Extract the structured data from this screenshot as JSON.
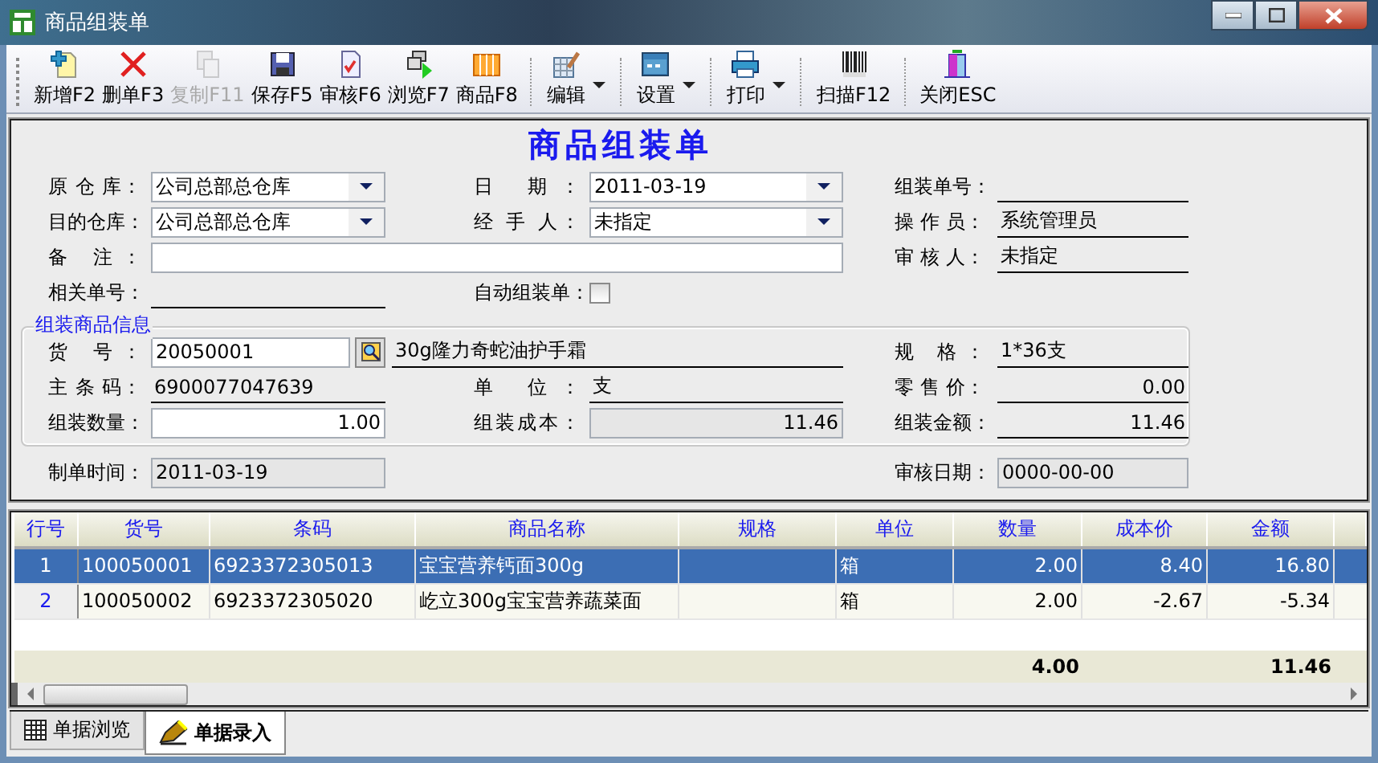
{
  "window": {
    "title": "商品组装单"
  },
  "toolbar": [
    {
      "kind": "button",
      "label": "新增F2",
      "disabled": false,
      "dropdown": false
    },
    {
      "kind": "button",
      "label": "删单F3",
      "disabled": false,
      "dropdown": false
    },
    {
      "kind": "button",
      "label": "复制F11",
      "disabled": true,
      "dropdown": false
    },
    {
      "kind": "button",
      "label": "保存F5",
      "disabled": false,
      "dropdown": false
    },
    {
      "kind": "button",
      "label": "审核F6",
      "disabled": false,
      "dropdown": false
    },
    {
      "kind": "button",
      "label": "浏览F7",
      "disabled": false,
      "dropdown": false
    },
    {
      "kind": "button",
      "label": "商品F8",
      "disabled": false,
      "dropdown": false
    },
    {
      "kind": "separator"
    },
    {
      "kind": "button",
      "label": "编辑",
      "disabled": false,
      "dropdown": true
    },
    {
      "kind": "separator"
    },
    {
      "kind": "button",
      "label": "设置",
      "disabled": false,
      "dropdown": true
    },
    {
      "kind": "separator"
    },
    {
      "kind": "button",
      "label": "打印",
      "disabled": false,
      "dropdown": true
    },
    {
      "kind": "separator"
    },
    {
      "kind": "button",
      "label": "扫描F12",
      "disabled": false,
      "dropdown": false
    },
    {
      "kind": "separator"
    },
    {
      "kind": "button",
      "label": "关闭ESC",
      "disabled": false,
      "dropdown": false
    }
  ],
  "form": {
    "title": "商品组装单",
    "rows": [
      {
        "left": {
          "label": "原 仓 库：",
          "kind": "combo",
          "value": "公司总部总仓库"
        },
        "middle": {
          "label": "日 期：",
          "kind": "combo",
          "value": "2011-03-19"
        },
        "right": {
          "label": "组装单号：",
          "kind": "line"
        }
      },
      {
        "left": {
          "label": "目的仓库：",
          "kind": "combo",
          "value": "公司总部总仓库"
        },
        "middle": {
          "label": "经 手 人：",
          "kind": "combo",
          "value": "未指定"
        },
        "right": {
          "label": "操 作 员：",
          "kind": "line",
          "value": "系统管理员"
        }
      },
      {
        "left": {
          "label": "备 注：",
          "kind": "wide-input"
        },
        "right": {
          "label": "审 核 人：",
          "kind": "line",
          "value": "未指定"
        }
      },
      {
        "left": {
          "label": "相关单号：",
          "kind": "line"
        },
        "middle": {
          "label": "自动组装单：",
          "kind": "checkbox",
          "checked": false
        }
      }
    ],
    "group": {
      "title": "组装商品信息",
      "rows": [
        {
          "left": {
            "label": "货 号：",
            "kind": "lookup",
            "value": "20050001"
          },
          "middle": {
            "kind": "name-line",
            "value": "30g隆力奇蛇油护手霜"
          },
          "right": {
            "label": "规 格：",
            "kind": "line",
            "value": "1*36支"
          }
        },
        {
          "left": {
            "label": "主 条 码：",
            "kind": "line",
            "value": "6900077047639"
          },
          "middle": {
            "label": "单 位：",
            "kind": "line",
            "value": "支"
          },
          "right": {
            "label": "零 售 价：",
            "kind": "line-num",
            "value": "0.00"
          }
        },
        {
          "left": {
            "label": "组装数量：",
            "kind": "input-num",
            "value": "1.00"
          },
          "middle": {
            "label": "组装成本：",
            "kind": "readonly-num",
            "value": "11.46"
          },
          "right": {
            "label": "组装金额：",
            "kind": "line-num",
            "value": "11.46"
          }
        }
      ]
    },
    "footer_rows": [
      {
        "left": {
          "label": "制单时间：",
          "kind": "readonly",
          "value": "2011-03-19"
        },
        "right": {
          "label": "审核日期：",
          "kind": "readonly",
          "value": "0000-00-00"
        }
      }
    ]
  },
  "table": {
    "columns": [
      "行号",
      "货号",
      "条码",
      "商品名称",
      "规格",
      "单位",
      "数量",
      "成本价",
      "金额"
    ],
    "rows": [
      {
        "selected": true,
        "cells": [
          "1",
          "100050001",
          "6923372305013",
          "宝宝营养钙面300g",
          "",
          "箱",
          "2.00",
          "8.40",
          "16.80"
        ]
      },
      {
        "selected": false,
        "cells": [
          "2",
          "100050002",
          "6923372305020",
          "屹立300g宝宝营养蔬菜面",
          "",
          "箱",
          "2.00",
          "-2.67",
          "-5.34"
        ]
      }
    ],
    "totals": {
      "quantity": "4.00",
      "amount": "11.46"
    }
  },
  "tabs": [
    {
      "label": "单据浏览",
      "selected": false
    },
    {
      "label": "单据录入",
      "selected": true
    }
  ]
}
